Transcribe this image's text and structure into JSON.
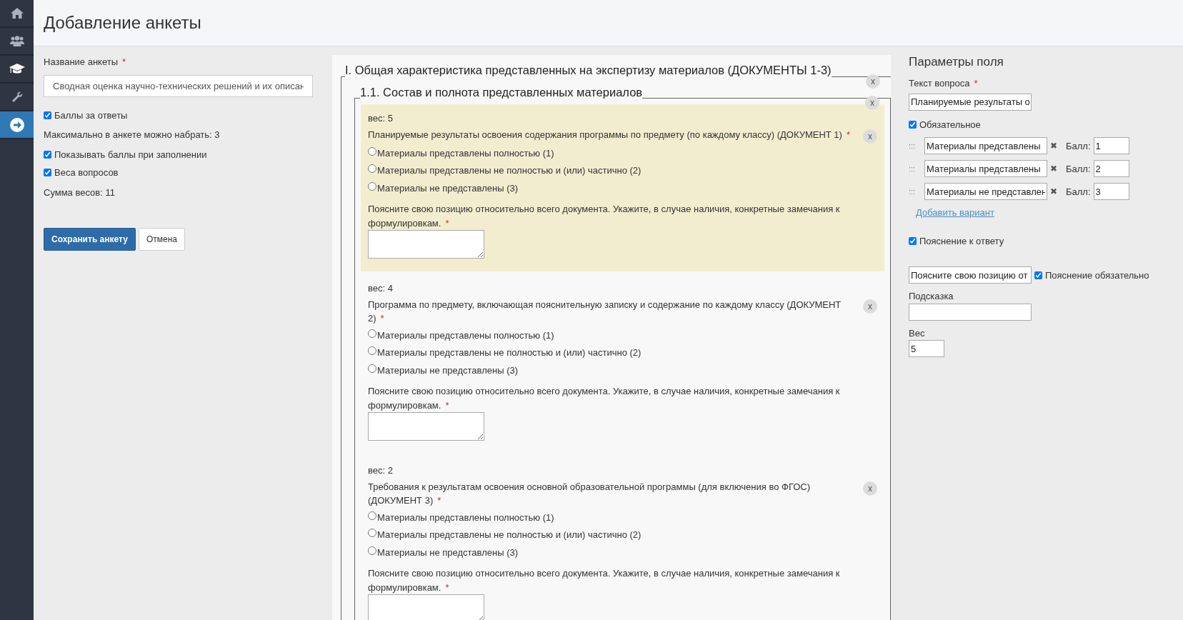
{
  "sidebar": {
    "items": [
      {
        "kind": "home",
        "selected": false
      },
      {
        "kind": "users",
        "selected": false
      },
      {
        "kind": "cap",
        "selected": false
      },
      {
        "kind": "wrench",
        "selected": false
      },
      {
        "kind": "arrow",
        "selected": true
      }
    ]
  },
  "header": {
    "title": "Добавление анкеты"
  },
  "form": {
    "name_label": "Название анкеты",
    "name_required_mark": "*",
    "name_value": "Сводная оценка научно-технических решений и их описан",
    "items": [
      {
        "kind": "checkbox",
        "label": "Баллы за ответы",
        "checked": true
      },
      {
        "kind": "text",
        "text": "Максимально в анкете можно набрать: 3"
      },
      {
        "kind": "checkbox",
        "label": "Показывать баллы при заполнении",
        "checked": true
      },
      {
        "kind": "checkbox",
        "label": "Веса вопросов",
        "checked": true
      },
      {
        "kind": "text",
        "text": "Сумма весов: 11"
      }
    ],
    "buttons": [
      {
        "label": "Сохранить анкету",
        "kind": "primary"
      },
      {
        "label": "Отмена",
        "kind": "default"
      }
    ]
  },
  "sections": [
    {
      "title": "I. Общая характеристика представленных на экспертизу материалов (ДОКУМЕНТЫ 1-3)",
      "close": "x",
      "children": [
        {
          "title": "1.1. Состав и полнота представленных материалов",
          "close": "x",
          "questions": [
            {
              "weight": "вес: 5",
              "text": "Планируемые результаты освоения содержания программы по предмету (по каждому классу) (ДОКУМЕНТ 1)",
              "required_mark": "*",
              "selected": true,
              "close": "x",
              "options": [
                {
                  "label": "Материалы представлены полностью (1)",
                  "checked": false
                },
                {
                  "label": "Материалы представлены не полностью и (или) частично (2)",
                  "checked": false
                },
                {
                  "label": "Материалы не представлены (3)",
                  "checked": false
                }
              ],
              "comment_label": "Поясните свою позицию относительно всего документа. Укажите, в случае наличия, конкретные замечания к формулировкам.",
              "comment_required_mark": "*"
            },
            {
              "weight": "вес: 4",
              "text": "Программа по предмету, включающая пояснительную записку и содержание по каждому классу (ДОКУМЕНТ 2)",
              "required_mark": "*",
              "selected": false,
              "close": "x",
              "options": [
                {
                  "label": "Материалы представлены полностью (1)",
                  "checked": false
                },
                {
                  "label": "Материалы представлены не полностью и (или) частично (2)",
                  "checked": false
                },
                {
                  "label": "Материалы не представлены (3)",
                  "checked": false
                }
              ],
              "comment_label": "Поясните свою позицию относительно всего документа. Укажите, в случае наличия, конкретные замечания к формулировкам.",
              "comment_required_mark": "*"
            },
            {
              "weight": "вес: 2",
              "text": "Требования к результатам освоения основной образовательной программы (для включения во ФГОС) (ДОКУМЕНТ 3)",
              "required_mark": "*",
              "selected": false,
              "close": "x",
              "options": [
                {
                  "label": "Материалы представлены полностью (1)",
                  "checked": false
                },
                {
                  "label": "Материалы представлены не полностью и (или) частично (2)",
                  "checked": false
                },
                {
                  "label": "Материалы не представлены (3)",
                  "checked": false
                }
              ],
              "comment_label": "Поясните свою позицию относительно всего документа. Укажите, в случае наличия, конкретные замечания к формулировкам.",
              "comment_required_mark": "*"
            }
          ]
        }
      ]
    }
  ],
  "field_params": {
    "title": "Параметры поля",
    "question_label": "Текст вопроса",
    "question_required_mark": "*",
    "question_value": "Планируемые результаты о",
    "required_check": {
      "label": "Обязательное",
      "checked": true
    },
    "variants": [
      {
        "handle": ":::",
        "value": "Материалы представлены",
        "remove": "✖",
        "score_label": "Балл:",
        "score": "1"
      },
      {
        "handle": ":::",
        "value": "Материалы представлены",
        "remove": "✖",
        "score_label": "Балл:",
        "score": "2"
      },
      {
        "handle": ":::",
        "value": "Материалы не представлен",
        "remove": "✖",
        "score_label": "Балл:",
        "score": "3"
      }
    ],
    "add_variant": "Добавить вариант",
    "comment_check": {
      "label": "Пояснение к ответу",
      "checked": true
    },
    "comment_value": "Поясните свою позицию от",
    "comment_required_check": {
      "label": "Пояснение обязательно",
      "checked": true
    },
    "hint_label": "Подсказка",
    "weight_label": "Вес",
    "weight_value": "5"
  }
}
